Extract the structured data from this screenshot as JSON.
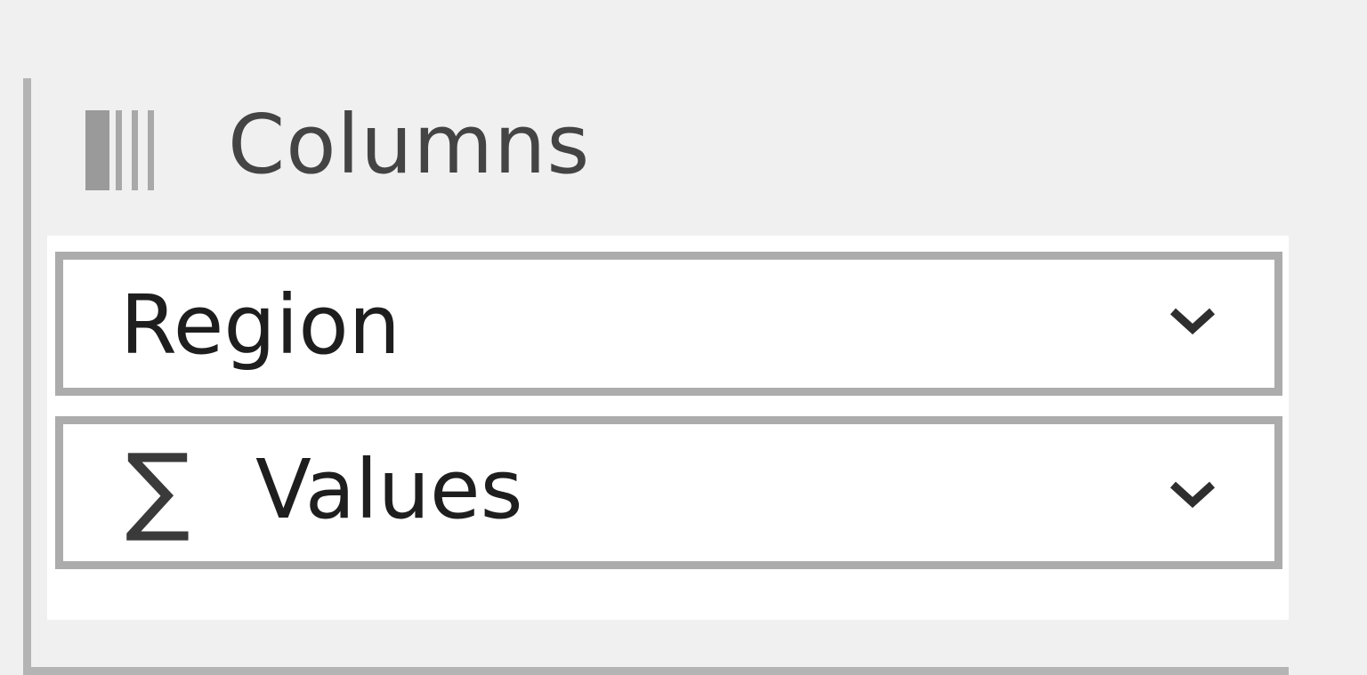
{
  "columns_area": {
    "title": "Columns",
    "icon": "columns-icon",
    "fields": [
      {
        "label": "Region",
        "icon": null,
        "menu_icon": "chevron-down-icon"
      },
      {
        "label": "Values",
        "icon": "sigma-icon",
        "menu_icon": "chevron-down-icon"
      }
    ]
  },
  "colors": {
    "background": "#f0f0f0",
    "field_border": "#acacac",
    "drop_area": "#ffffff"
  }
}
